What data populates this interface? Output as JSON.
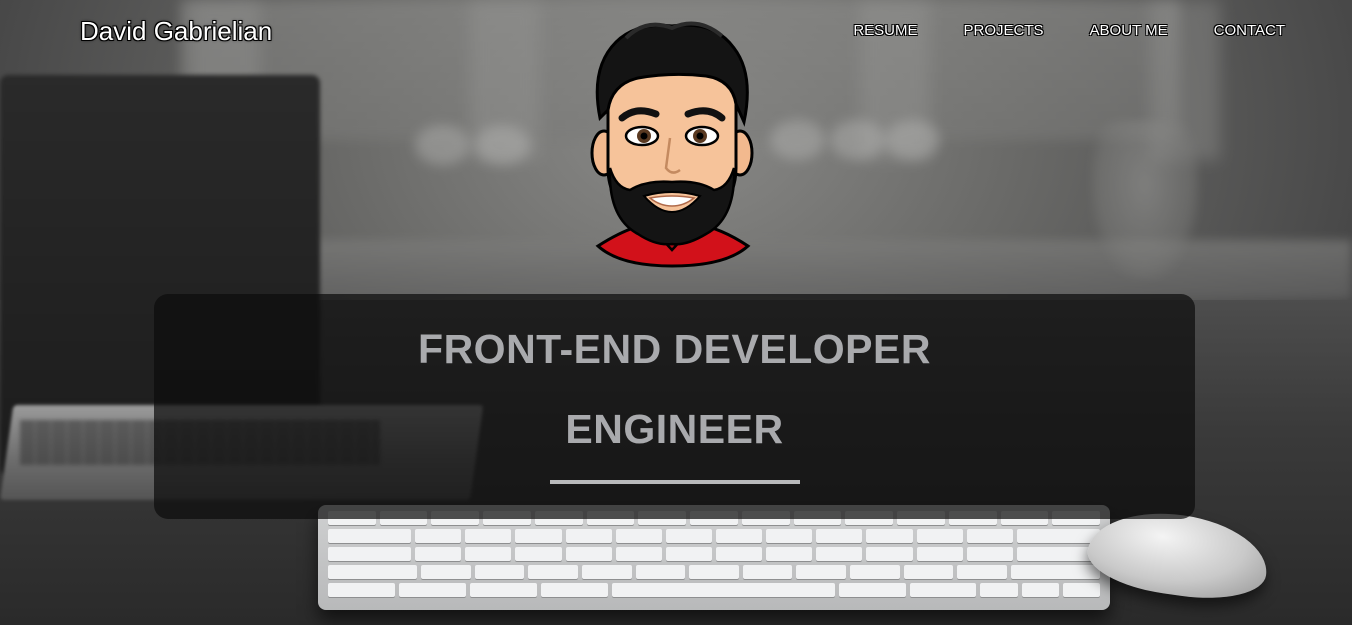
{
  "brand": {
    "name": "David Gabrielian"
  },
  "nav": {
    "items": [
      {
        "label": "RESUME"
      },
      {
        "label": "PROJECTS"
      },
      {
        "label": "ABOUT ME"
      },
      {
        "label": "CONTACT"
      }
    ]
  },
  "hero": {
    "avatar_icon": "cartoon-avatar-icon",
    "line1": "FRONT-END DEVELOPER",
    "line2": "ENGINEER"
  },
  "colors": {
    "nav_text": "#ffffff",
    "headline_text": "#a9aaad",
    "panel_bg": "rgba(12,12,12,0.72)",
    "shirt_red": "#d2111a"
  }
}
